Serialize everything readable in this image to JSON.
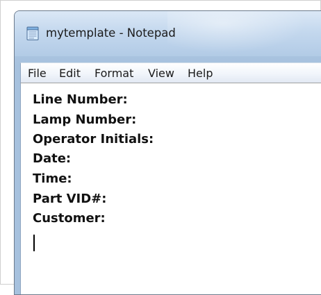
{
  "window": {
    "title": "mytemplate - Notepad",
    "app_icon": "notepad-icon"
  },
  "menubar": {
    "items": [
      {
        "label": "File"
      },
      {
        "label": "Edit"
      },
      {
        "label": "Format"
      },
      {
        "label": "View"
      },
      {
        "label": "Help"
      }
    ]
  },
  "editor": {
    "lines": [
      "Line Number:",
      "Lamp Number:",
      "Operator Initials:",
      "Date:",
      "Time:",
      "Part VID#:",
      "Customer:"
    ]
  },
  "colors": {
    "titlebar_gradient_top": "#dbe8f6",
    "titlebar_gradient_bottom": "#b2cbe6",
    "window_border": "#6b7a8c",
    "text": "#111111"
  }
}
